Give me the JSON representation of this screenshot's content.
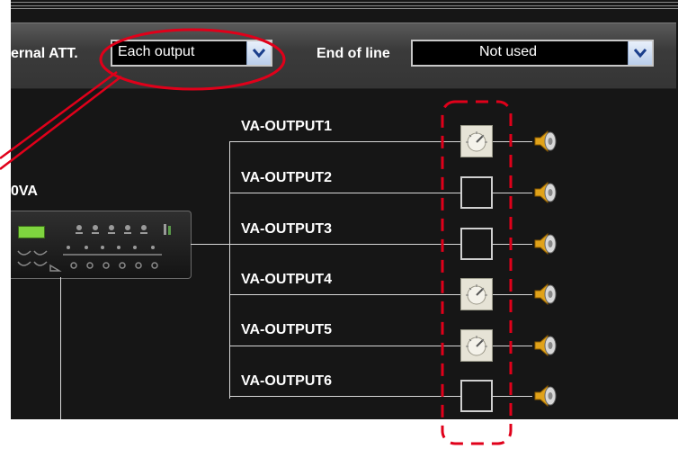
{
  "toolbar": {
    "att_label": "ernal ATT.",
    "att_value": "Each output",
    "eol_label": "End of line",
    "eol_value": "Not used"
  },
  "device": {
    "name": "0VA"
  },
  "outputs": [
    {
      "label": "VA-OUTPUT1",
      "attenuator": "knob"
    },
    {
      "label": "VA-OUTPUT2",
      "attenuator": "empty"
    },
    {
      "label": "VA-OUTPUT3",
      "attenuator": "empty"
    },
    {
      "label": "VA-OUTPUT4",
      "attenuator": "knob"
    },
    {
      "label": "VA-OUTPUT5",
      "attenuator": "knob"
    },
    {
      "label": "VA-OUTPUT6",
      "attenuator": "empty"
    }
  ],
  "colors": {
    "annotation": "#e0001a",
    "background": "#161616"
  },
  "icons": {
    "attenuator": "attenuator-knob-icon",
    "speaker": "speaker-icon",
    "dropdown": "chevron-down-icon"
  }
}
